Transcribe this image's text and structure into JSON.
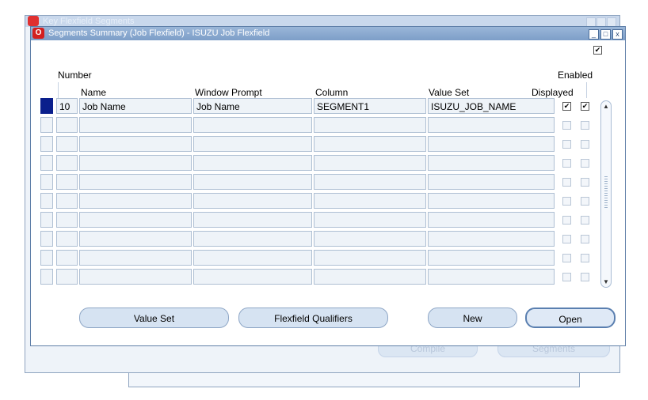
{
  "background_windows": {
    "back_title": "Key Flexfield Segments",
    "compile_label": "Compile",
    "segments_label": "Segments"
  },
  "window": {
    "title": "Segments Summary (Job Flexfield) - ISUZU Job Flexfield",
    "minimize": "_",
    "maximize": "□",
    "close": "x"
  },
  "headers": {
    "number": "Number",
    "name": "Name",
    "window_prompt": "Window Prompt",
    "column": "Column",
    "value_set": "Value Set",
    "displayed": "Displayed",
    "enabled": "Enabled"
  },
  "rows": [
    {
      "number": "10",
      "name": "Job Name",
      "window_prompt": "Job Name",
      "column": "SEGMENT1",
      "value_set": "ISUZU_JOB_NAME",
      "displayed": true,
      "enabled": true
    },
    {
      "number": "",
      "name": "",
      "window_prompt": "",
      "column": "",
      "value_set": "",
      "displayed": false,
      "enabled": false
    },
    {
      "number": "",
      "name": "",
      "window_prompt": "",
      "column": "",
      "value_set": "",
      "displayed": false,
      "enabled": false
    },
    {
      "number": "",
      "name": "",
      "window_prompt": "",
      "column": "",
      "value_set": "",
      "displayed": false,
      "enabled": false
    },
    {
      "number": "",
      "name": "",
      "window_prompt": "",
      "column": "",
      "value_set": "",
      "displayed": false,
      "enabled": false
    },
    {
      "number": "",
      "name": "",
      "window_prompt": "",
      "column": "",
      "value_set": "",
      "displayed": false,
      "enabled": false
    },
    {
      "number": "",
      "name": "",
      "window_prompt": "",
      "column": "",
      "value_set": "",
      "displayed": false,
      "enabled": false
    },
    {
      "number": "",
      "name": "",
      "window_prompt": "",
      "column": "",
      "value_set": "",
      "displayed": false,
      "enabled": false
    },
    {
      "number": "",
      "name": "",
      "window_prompt": "",
      "column": "",
      "value_set": "",
      "displayed": false,
      "enabled": false
    },
    {
      "number": "",
      "name": "",
      "window_prompt": "",
      "column": "",
      "value_set": "",
      "displayed": false,
      "enabled": false
    }
  ],
  "buttons": {
    "value_set": "Value Set",
    "flexfield_qualifiers": "Flexfield Qualifiers",
    "new": "New",
    "open": "Open"
  },
  "icons": {
    "app": "oracle-logo-icon",
    "check": "checkmark-icon",
    "scroll_up": "scroll-up-arrow-icon",
    "scroll_down": "scroll-down-arrow-icon"
  },
  "colors": {
    "title_bar": "#7d9ec8",
    "active_row_indicator": "#0a1f8c",
    "field_bg": "#eef3f8",
    "button_bg": "#d6e3f2"
  }
}
